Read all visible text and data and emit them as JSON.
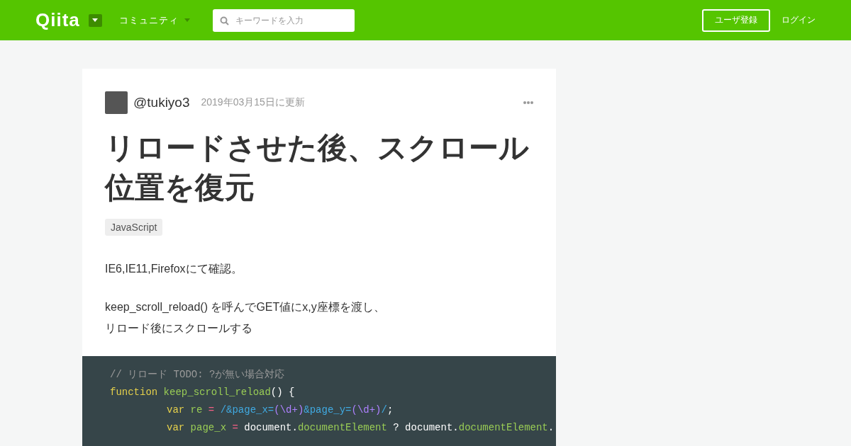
{
  "header": {
    "logo": "Qiita",
    "community": "コミュニティ",
    "search": {
      "placeholder": "キーワードを入力"
    },
    "signup": "ユーザ登録",
    "login": "ログイン"
  },
  "article": {
    "author": "@tukiyo3",
    "updated": "2019年03月15日に更新",
    "title": "リロードさせた後、スクロール位置を復元",
    "tags": [
      "JavaScript"
    ],
    "paragraphs": [
      [
        "IE6,IE11,Firefoxにて確認。"
      ],
      [
        "keep_scroll_reload() を呼んでGET値にx,y座標を渡し、",
        "リロード後にスクロールする"
      ]
    ],
    "code": [
      {
        "indent": false,
        "tokens": [
          {
            "kind": "comment",
            "text": "// リロード TODO: ?が無い場合対応"
          }
        ]
      },
      {
        "indent": false,
        "tokens": [
          {
            "kind": "keyword",
            "text": "function"
          },
          {
            "kind": "name",
            "text": " keep_scroll_reload"
          },
          {
            "kind": "plain",
            "text": "() {"
          }
        ]
      },
      {
        "indent": true,
        "tokens": [
          {
            "kind": "keyword",
            "text": "var"
          },
          {
            "kind": "name",
            "text": " re"
          },
          {
            "kind": "op",
            "text": " = "
          },
          {
            "kind": "regex",
            "text": "/&page_x="
          },
          {
            "kind": "group",
            "text": "(\\d+)"
          },
          {
            "kind": "regex",
            "text": "&page_y="
          },
          {
            "kind": "group",
            "text": "(\\d+)"
          },
          {
            "kind": "regex",
            "text": "/"
          },
          {
            "kind": "plain",
            "text": ";"
          }
        ]
      },
      {
        "indent": true,
        "tokens": [
          {
            "kind": "keyword",
            "text": "var"
          },
          {
            "kind": "name",
            "text": " page_x"
          },
          {
            "kind": "op",
            "text": " = "
          },
          {
            "kind": "plain",
            "text": "document."
          },
          {
            "kind": "name",
            "text": "documentElement"
          },
          {
            "kind": "plain",
            "text": " ? document."
          },
          {
            "kind": "name",
            "text": "documentElement"
          },
          {
            "kind": "plain",
            "text": "."
          }
        ]
      }
    ]
  }
}
